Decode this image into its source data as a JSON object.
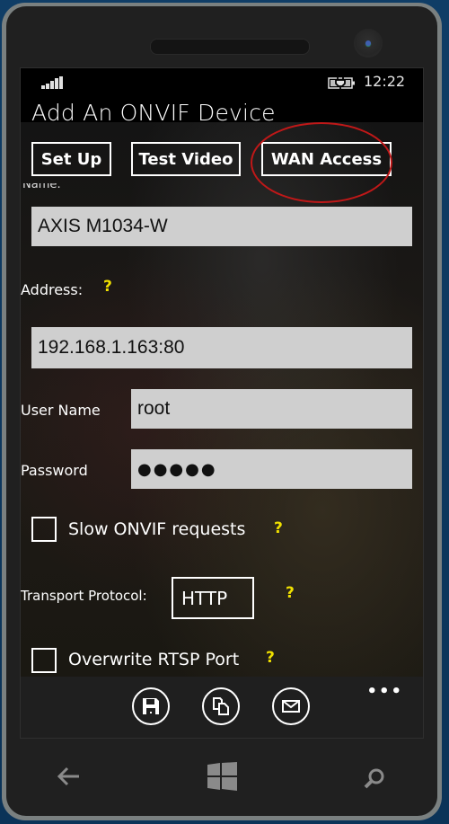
{
  "status_bar": {
    "time": "12:22",
    "signal_icon": "signal-bars-icon",
    "battery_icon": "battery-charging-icon"
  },
  "page": {
    "title": "Add An ONVIF Device"
  },
  "tabs": [
    {
      "label": "Set Up"
    },
    {
      "label": "Test Video"
    },
    {
      "label": "WAN Access",
      "highlighted": true
    }
  ],
  "highlight_color": "#c01818",
  "form": {
    "name_label": "Name:",
    "name_value": "AXIS M1034-W",
    "address_label": "Address:",
    "address_value": "192.168.1.163:80",
    "username_label": "User Name",
    "username_value": "root",
    "password_label": "Password",
    "password_value": "●●●●●",
    "slow_onvif_label": "Slow ONVIF requests",
    "slow_onvif_checked": false,
    "transport_label": "Transport Protocol:",
    "transport_value": "HTTP",
    "overwrite_rtsp_label": "Overwrite RTSP Port",
    "overwrite_rtsp_checked": false,
    "help_glyph": "?",
    "help_color": "#f0e000"
  },
  "app_bar": {
    "buttons": [
      {
        "icon": "save-icon"
      },
      {
        "icon": "copy-icon"
      },
      {
        "icon": "mail-icon"
      }
    ],
    "more_label": "•••"
  },
  "hardware_buttons": [
    "back-icon",
    "windows-start-icon",
    "search-icon"
  ]
}
